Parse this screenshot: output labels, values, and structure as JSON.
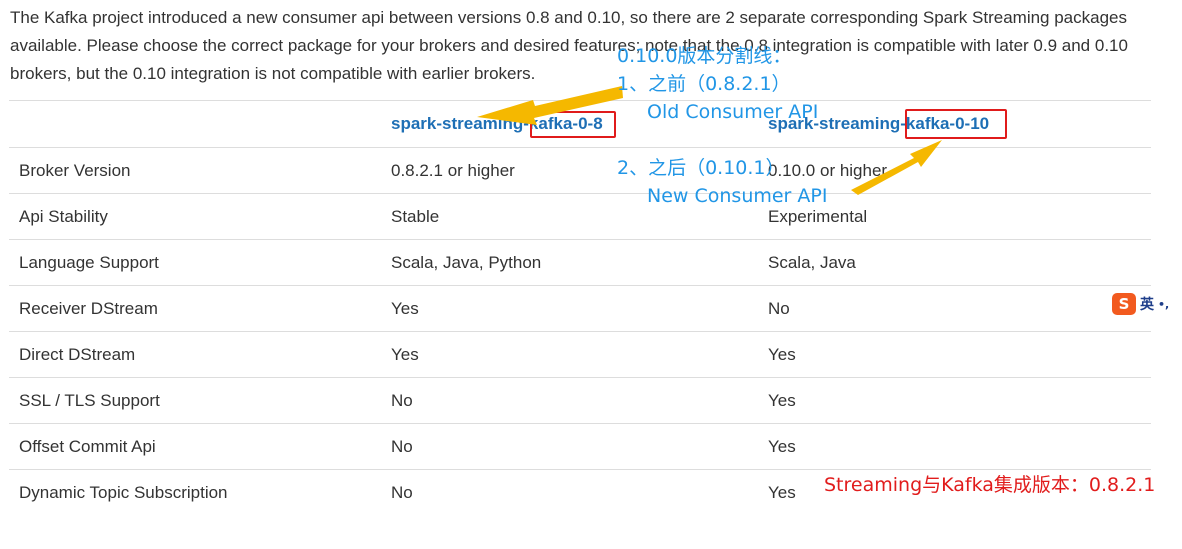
{
  "intro_text": "The Kafka project introduced a new consumer api between versions 0.8 and 0.10, so there are 2 separate corresponding Spark Streaming packages available. Please choose the correct package for your brokers and desired features; note that the 0.8 integration is compatible with later 0.9 and 0.10 brokers, but the 0.10 integration is not compatible with earlier brokers.",
  "table": {
    "header": [
      "",
      "spark-streaming-kafka-0-8",
      "spark-streaming-kafka-0-10"
    ],
    "rows": [
      [
        "Broker Version",
        "0.8.2.1 or higher",
        "0.10.0 or higher"
      ],
      [
        "Api Stability",
        "Stable",
        "Experimental"
      ],
      [
        "Language Support",
        "Scala, Java, Python",
        "Scala, Java"
      ],
      [
        "Receiver DStream",
        "Yes",
        "No"
      ],
      [
        "Direct DStream",
        "Yes",
        "Yes"
      ],
      [
        "SSL / TLS Support",
        "No",
        "Yes"
      ],
      [
        "Offset Commit Api",
        "No",
        "Yes"
      ],
      [
        "Dynamic Topic Subscription",
        "No",
        "Yes"
      ]
    ]
  },
  "annotations": {
    "divider": "0.10.0版本分割线：",
    "before": "1、之前（0.8.2.1）",
    "old_api": "Old Consumer API",
    "after": "2、之后（0.10.1）",
    "new_api": "New Consumer API",
    "integration": "Streaming与Kafka集成版本：0.8.2.1"
  },
  "ime": {
    "logo": "S",
    "label": "英",
    "extra": "•,"
  },
  "colors": {
    "annotation_blue": "#2196e6",
    "annotation_red": "#e11c1c",
    "arrow": "#f5b800",
    "link": "#1e6fb5"
  }
}
